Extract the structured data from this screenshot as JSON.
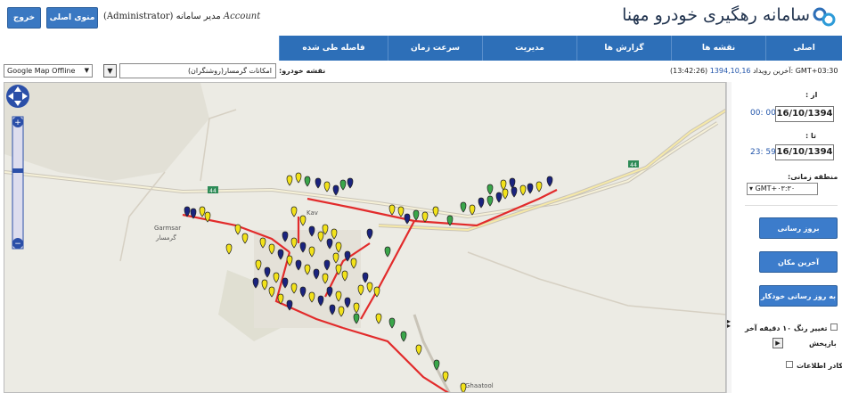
{
  "header": {
    "app_title": "سامانه رهگیری خودرو مهنا",
    "logout_label": "خروج",
    "home_label": "منوی اصلی",
    "user_text": "(Administrator) مدیر سامانه",
    "account_label": "Account"
  },
  "nav": {
    "tabs": [
      {
        "label": "اصلی",
        "width": 86
      },
      {
        "label": "نقشه ها",
        "width": 106
      },
      {
        "label": "گزارش ها",
        "width": 106
      },
      {
        "label": "مدیریت",
        "width": 106
      },
      {
        "label": "سرعت زمان",
        "width": 106
      },
      {
        "label": "فاصله طی شده",
        "width": 122
      }
    ]
  },
  "toolbar": {
    "map_type": "Google Map Offline",
    "car_label": "نقشه خودرو:",
    "car_value": "امکانات گرمسار(روشنگران)",
    "gmt": "GMT+03:30",
    "last_event_label": "آخرین رویداد:",
    "last_event_date": "1394,10,16",
    "last_event_time": "(13:42:26)"
  },
  "map": {
    "place_garmsar": "Garmsar",
    "place_garmsar_fa": "گرمسار",
    "place_ghaatool": "Ghaatool",
    "place_kav": "Kav",
    "road_44": "44"
  },
  "side": {
    "from_label": "از :",
    "from_time": "00: 00",
    "from_date": "16/10/1394",
    "to_label": "تا :",
    "to_time": "23: 59",
    "to_date": "16/10/1394",
    "tz_label": "منطقه زمانی:",
    "tz_value": "GMT+۰۳:۳۰",
    "refresh_label": "بروز رسانی",
    "last_location_label": "آخرین مکان",
    "auto_refresh_label": "به روز رسانی خودکار",
    "color_change_label": "تغییر رنگ ۱۰ دقیقه آخر",
    "playback_label": "بازپخش",
    "info_window_label": "کادر اطلاعات"
  },
  "colors": {
    "nav_bg": "#2d6fb8",
    "button_bg": "#3c7ccb",
    "route": "#e22b2b",
    "marker_yellow": "#f2e21a",
    "marker_navy": "#1a237e",
    "marker_green": "#3aa64a"
  }
}
